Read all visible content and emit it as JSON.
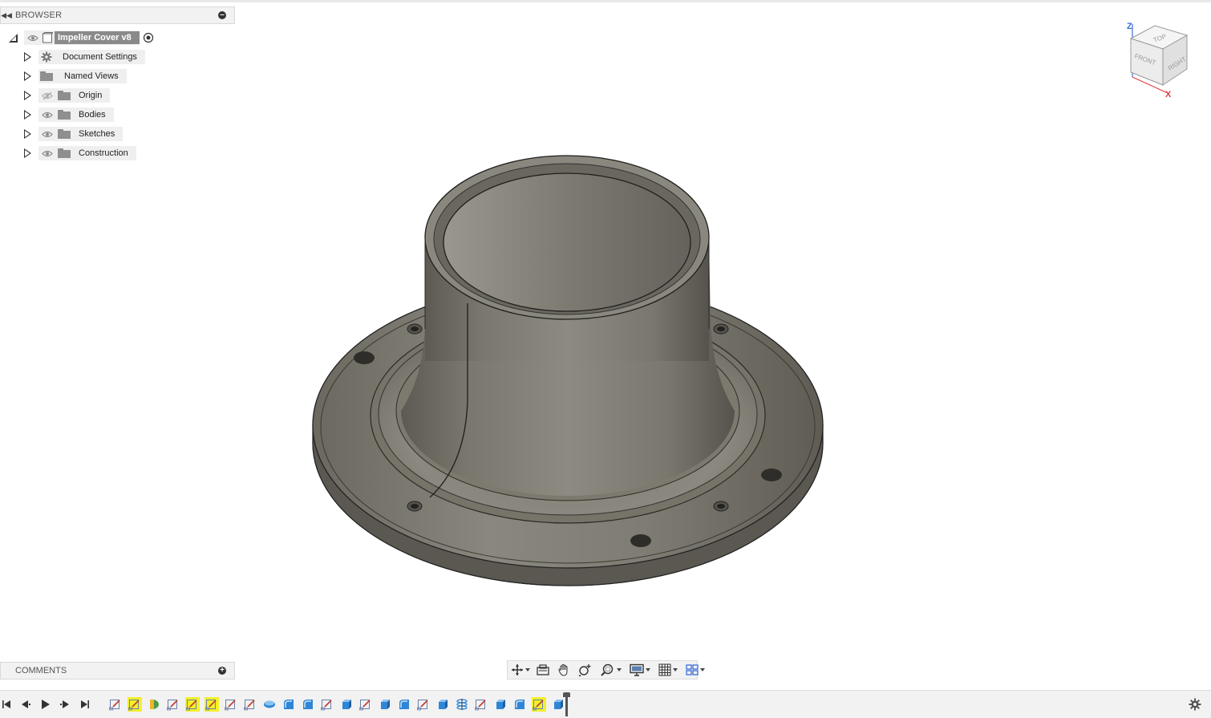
{
  "browser": {
    "title": "BROWSER",
    "component": {
      "label": "Impeller Cover v8"
    },
    "items": [
      {
        "label": "Document Settings",
        "icon": "gear-icon",
        "visible": null
      },
      {
        "label": "Named Views",
        "icon": "folder-icon",
        "visible": null
      },
      {
        "label": "Origin",
        "icon": "folder-icon",
        "visible": false
      },
      {
        "label": "Bodies",
        "icon": "folder-icon",
        "visible": true
      },
      {
        "label": "Sketches",
        "icon": "folder-icon",
        "visible": true
      },
      {
        "label": "Construction",
        "icon": "folder-icon",
        "visible": true
      }
    ]
  },
  "comments": {
    "title": "COMMENTS"
  },
  "viewcube": {
    "top": "TOP",
    "front": "FRONT",
    "right": "RIGHT",
    "axis_z": "Z",
    "axis_x": "X"
  },
  "nav_toolbar": [
    "orbit",
    "look-at",
    "pan",
    "zoom-window",
    "zoom-fit",
    "display-settings",
    "grid-settings",
    "viewports"
  ],
  "timeline": {
    "controls": [
      "go-to-start",
      "step-back",
      "play",
      "step-forward",
      "go-to-end"
    ],
    "features": [
      {
        "type": "sketch",
        "highlight": false
      },
      {
        "type": "sketch",
        "highlight": true
      },
      {
        "type": "revolve",
        "highlight": false
      },
      {
        "type": "sketch",
        "highlight": false
      },
      {
        "type": "sketch",
        "highlight": true
      },
      {
        "type": "sketch",
        "highlight": true
      },
      {
        "type": "sketch",
        "highlight": false
      },
      {
        "type": "sketch",
        "highlight": false
      },
      {
        "type": "body",
        "highlight": false
      },
      {
        "type": "fillet",
        "highlight": false
      },
      {
        "type": "fillet",
        "highlight": false
      },
      {
        "type": "sketch",
        "highlight": false
      },
      {
        "type": "extrude",
        "highlight": false
      },
      {
        "type": "sketch",
        "highlight": false
      },
      {
        "type": "extrude",
        "highlight": false
      },
      {
        "type": "fillet",
        "highlight": false
      },
      {
        "type": "sketch",
        "highlight": false
      },
      {
        "type": "extrude",
        "highlight": false
      },
      {
        "type": "pattern",
        "highlight": false
      },
      {
        "type": "sketch",
        "highlight": false
      },
      {
        "type": "extrude",
        "highlight": false
      },
      {
        "type": "fillet",
        "highlight": false
      },
      {
        "type": "sketch",
        "highlight": true
      },
      {
        "type": "extrude",
        "highlight": false
      }
    ]
  },
  "colors": {
    "panel_bg": "#f2f2f2",
    "highlight": "#f3f02a",
    "feature_blue": "#2f86d6",
    "model_metal": "#7d7a72"
  }
}
